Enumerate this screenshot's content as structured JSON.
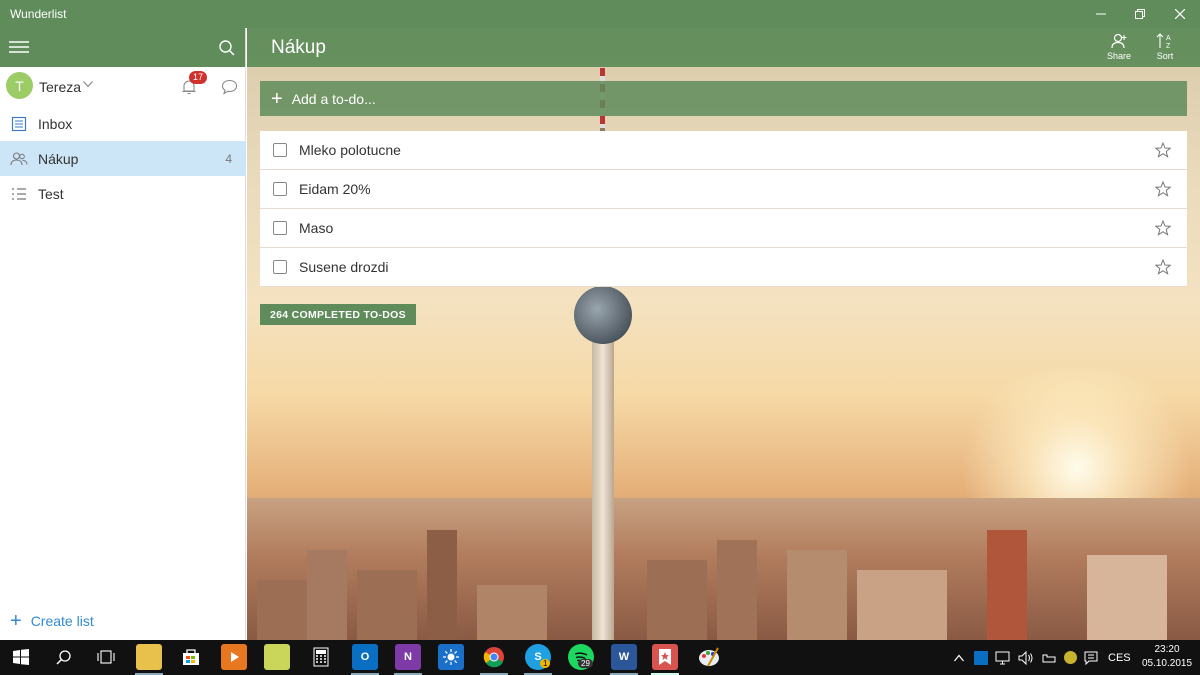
{
  "window": {
    "title": "Wunderlist"
  },
  "sidebar": {
    "user": {
      "initial": "T",
      "name": "Tereza"
    },
    "notifications_count": "17",
    "lists": [
      {
        "label": "Inbox",
        "count": "",
        "icon": "inbox-icon"
      },
      {
        "label": "Nákup",
        "count": "4",
        "icon": "shared-list-icon",
        "active": true
      },
      {
        "label": "Test",
        "count": "",
        "icon": "list-icon"
      }
    ],
    "create_list_label": "Create list"
  },
  "main": {
    "list_title": "Nákup",
    "share_label": "Share",
    "sort_label": "Sort",
    "add_placeholder": "Add a to-do...",
    "todos": [
      {
        "label": "Mleko polotucne",
        "starred": false
      },
      {
        "label": "Eidam 20%",
        "starred": false
      },
      {
        "label": "Maso",
        "starred": false
      },
      {
        "label": "Susene drozdi",
        "starred": false
      }
    ],
    "completed_label": "264 COMPLETED TO-DOS"
  },
  "taskbar": {
    "apps": [
      "file-explorer-icon",
      "store-icon",
      "media-player-icon",
      "mail-icon",
      "calculator-icon",
      "outlook-icon",
      "onenote-icon",
      "weather-icon",
      "chrome-icon",
      "skype-icon",
      "spotify-icon",
      "word-icon",
      "wunderlist-icon",
      "paint-icon"
    ],
    "outlook_letter": "O",
    "onenote_letter": "N",
    "skype_letter": "S",
    "word_letter": "W",
    "skype_badge": "1",
    "spotify_badge": "29",
    "language": "CES",
    "time": "23:20",
    "date": "05.10.2015"
  },
  "colors": {
    "accent_green": "#5f8c5a",
    "active_list": "#cde6f7",
    "badge_red": "#d0312d",
    "link_blue": "#328ad6"
  }
}
